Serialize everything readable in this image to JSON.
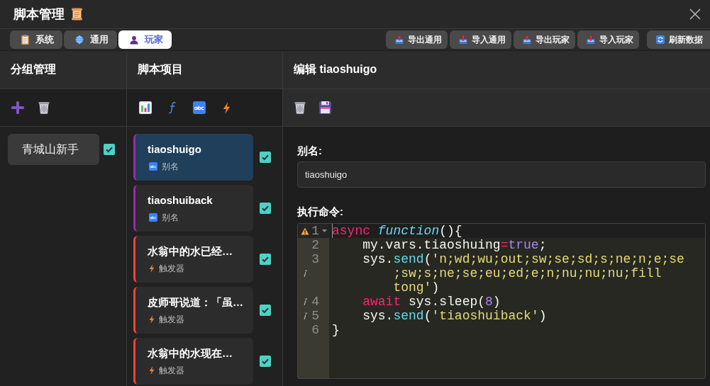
{
  "window": {
    "title": "脚本管理"
  },
  "tabs": [
    {
      "label": "系统",
      "selected": false
    },
    {
      "label": "通用",
      "selected": false
    },
    {
      "label": "玩家",
      "selected": true
    }
  ],
  "actions": [
    {
      "label": "导出通用",
      "kind": "export"
    },
    {
      "label": "导入通用",
      "kind": "import"
    },
    {
      "label": "导出玩家",
      "kind": "export"
    },
    {
      "label": "导入玩家",
      "kind": "import"
    },
    {
      "label": "刷新数据",
      "kind": "refresh"
    }
  ],
  "groups": {
    "title": "分组管理",
    "items": [
      {
        "label": "青城山新手",
        "checked": true
      }
    ]
  },
  "scripts": {
    "title": "脚本项目",
    "items": [
      {
        "name": "tiaoshuigo",
        "type_label": "别名",
        "kind": "alias",
        "selected": true,
        "checked": true
      },
      {
        "name": "tiaoshuiback",
        "type_label": "别名",
        "kind": "alias",
        "selected": false,
        "checked": true
      },
      {
        "name": "水翁中的水已经…",
        "type_label": "触发器",
        "kind": "trigger",
        "selected": false,
        "checked": true
      },
      {
        "name": "皮师哥说道：「虽…",
        "type_label": "触发器",
        "kind": "trigger",
        "selected": false,
        "checked": true
      },
      {
        "name": "水翁中的水现在…",
        "type_label": "触发器",
        "kind": "trigger",
        "selected": false,
        "checked": true
      }
    ]
  },
  "editor": {
    "title": "编辑 tiaoshuigo",
    "alias_label": "别名:",
    "alias_value": "tiaoshuigo",
    "command_label": "执行命令:",
    "lines": [
      {
        "number": "1",
        "active": true,
        "foldable": true,
        "warning": true,
        "info": false,
        "tokens": [
          {
            "kind": "keyword",
            "text": "async "
          },
          {
            "kind": "storage",
            "text": "function"
          },
          {
            "kind": "plain",
            "text": "(){"
          }
        ]
      },
      {
        "number": "2",
        "active": false,
        "foldable": false,
        "warning": false,
        "info": false,
        "tokens": [
          {
            "kind": "plain",
            "text": "    my.vars.tiaoshuing"
          },
          {
            "kind": "operator",
            "text": "="
          },
          {
            "kind": "constant",
            "text": "true"
          },
          {
            "kind": "plain",
            "text": ";"
          }
        ]
      },
      {
        "number": "3",
        "active": false,
        "foldable": false,
        "warning": false,
        "info": true,
        "tokens": [
          {
            "kind": "plain",
            "text": "    sys."
          },
          {
            "kind": "support",
            "text": "send"
          },
          {
            "kind": "plain",
            "text": "("
          },
          {
            "kind": "string",
            "text": "'n;wd;wu;out;sw;se;sd;s;ne;n;e;se;sw;s;ne;se;eu;ed;e;n;nu;nu;nu;fill tong'"
          },
          {
            "kind": "plain",
            "text": ")"
          }
        ]
      },
      {
        "number": "4",
        "active": false,
        "foldable": false,
        "warning": false,
        "info": true,
        "tokens": [
          {
            "kind": "keyword",
            "text": "    await"
          },
          {
            "kind": "plain",
            "text": " sys.sleep("
          },
          {
            "kind": "constant",
            "text": "8"
          },
          {
            "kind": "plain",
            "text": ")"
          }
        ]
      },
      {
        "number": "5",
        "active": false,
        "foldable": false,
        "warning": false,
        "info": true,
        "tokens": [
          {
            "kind": "plain",
            "text": "    sys."
          },
          {
            "kind": "support",
            "text": "send"
          },
          {
            "kind": "plain",
            "text": "("
          },
          {
            "kind": "string",
            "text": "'tiaoshuiback'"
          },
          {
            "kind": "plain",
            "text": ")"
          }
        ]
      },
      {
        "number": "6",
        "active": false,
        "foldable": false,
        "warning": false,
        "info": false,
        "tokens": [
          {
            "kind": "plain",
            "text": "}"
          }
        ]
      }
    ]
  }
}
